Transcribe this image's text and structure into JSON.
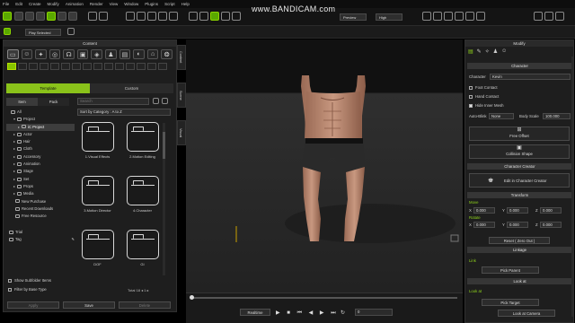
{
  "menubar": [
    "File",
    "Edit",
    "Create",
    "Modify",
    "Animation",
    "Render",
    "View",
    "Window",
    "Plugins",
    "Script",
    "Help"
  ],
  "watermark": "www.BANDICAM.com",
  "toolbar": {
    "select_mode": "Play Selected",
    "preview": "Preview",
    "quality": "High"
  },
  "content_panel": {
    "title": "Content",
    "tabs": [
      "Template",
      "Custom"
    ],
    "subtabs": [
      "Item",
      "Pack"
    ],
    "search_placeholder": "Search",
    "sort_label": "Sort by Category : A to Z",
    "tree": [
      {
        "label": "All",
        "level": 0,
        "arrow": "",
        "kind": "folder"
      },
      {
        "label": "Project",
        "level": 1,
        "arrow": "▾",
        "kind": "folder"
      },
      {
        "label": "iC Project",
        "level": 2,
        "arrow": "▸",
        "kind": "folder",
        "selected": true
      },
      {
        "label": "Actor",
        "level": 1,
        "arrow": "▸",
        "kind": "folder"
      },
      {
        "label": "Hair",
        "level": 1,
        "arrow": "▸",
        "kind": "folder"
      },
      {
        "label": "Cloth",
        "level": 1,
        "arrow": "▸",
        "kind": "folder"
      },
      {
        "label": "Accessory",
        "level": 1,
        "arrow": "▸",
        "kind": "folder"
      },
      {
        "label": "Animation",
        "level": 1,
        "arrow": "▸",
        "kind": "folder"
      },
      {
        "label": "Stage",
        "level": 1,
        "arrow": "▸",
        "kind": "folder"
      },
      {
        "label": "Set",
        "level": 1,
        "arrow": "▸",
        "kind": "folder"
      },
      {
        "label": "Props",
        "level": 1,
        "arrow": "▸",
        "kind": "folder"
      },
      {
        "label": "Media",
        "level": 1,
        "arrow": "▸",
        "kind": "folder"
      },
      {
        "label": "New Purchase",
        "level": 1,
        "arrow": "",
        "kind": "folder"
      },
      {
        "label": "Recent Downloads",
        "level": 1,
        "arrow": "",
        "kind": "folder"
      },
      {
        "label": "Free Resource",
        "level": 1,
        "arrow": "",
        "kind": "folder"
      }
    ],
    "tags": [
      "Trial",
      "Tag"
    ],
    "folders": [
      "1.Visual Effects",
      "2.Motion Editing",
      "3.Motion Director",
      "4.Character",
      "DOF",
      "GI"
    ],
    "options": [
      "Show Subfolder Items",
      "Filter by Base Type"
    ],
    "total_label": "Total",
    "total_value": "18",
    "page_nav": "◂ 1 ▸",
    "bottom_buttons": [
      "Apply",
      "Save",
      "Delete"
    ]
  },
  "side_tabs": [
    "Content",
    "Scene",
    "Visual"
  ],
  "timeline": {
    "mode": "Realtime",
    "frame": "0"
  },
  "modify_panel": {
    "title": "Modify",
    "character_section": "Character",
    "character_label": "Character",
    "character_name": "Kevin",
    "checks": [
      {
        "label": "Foot Contact",
        "checked": false
      },
      {
        "label": "Hand Contact",
        "checked": false
      },
      {
        "label": "Hide Inner Mesh",
        "checked": true
      }
    ],
    "autoblink_label": "Auto-Blink",
    "autoblink_value": "None",
    "bodyscale_label": "Body Scale",
    "bodyscale_value": "100.000",
    "free_offset": "Free Offset",
    "collision_shape": "Collision Shape",
    "creator_section": "Character Creator",
    "edit_in_cc": "Edit in Character Creator",
    "transform_section": "Transform",
    "move_label": "Move",
    "rotate_label": "Rotate",
    "x_label": "X",
    "y_label": "Y",
    "z_label": "Z",
    "move_x": "0.000",
    "move_y": "0.000",
    "move_z": "0.000",
    "rotate_x": "0.000",
    "rotate_y": "0.000",
    "rotate_z": "0.000",
    "reset_label": "Reset ( Zero Out )",
    "linkage_section": "Linkage",
    "link_label": "Link",
    "pick_parent": "Pick Parent",
    "lookat_section": "Look at",
    "lookat_label": "Look at",
    "pick_target": "Pick Target",
    "lookat_camera": "Look at Camera"
  }
}
